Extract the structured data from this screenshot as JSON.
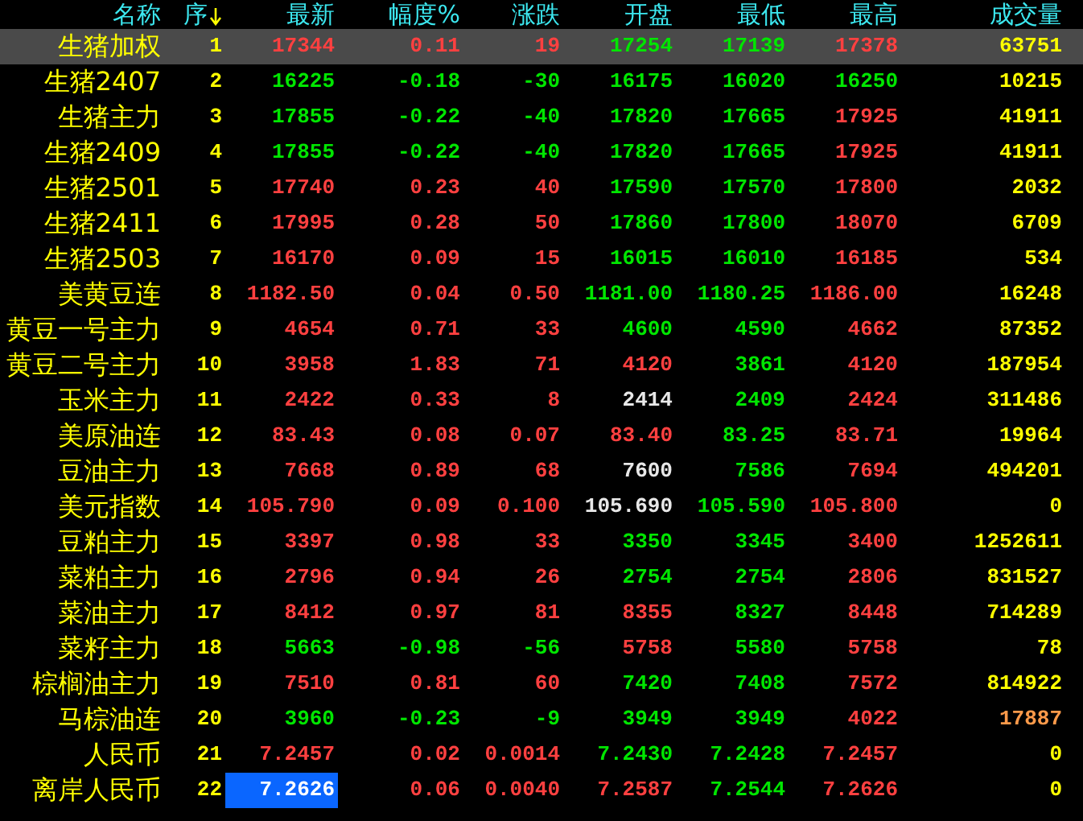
{
  "columns": [
    {
      "label": "名称",
      "sorted_descending": false
    },
    {
      "label": "序",
      "sorted_descending": true
    },
    {
      "label": "最新",
      "sorted_descending": false
    },
    {
      "label": "幅度%",
      "sorted_descending": false
    },
    {
      "label": "涨跌",
      "sorted_descending": false
    },
    {
      "label": "开盘",
      "sorted_descending": false
    },
    {
      "label": "最低",
      "sorted_descending": false
    },
    {
      "label": "最高",
      "sorted_descending": false
    },
    {
      "label": "成交量",
      "sorted_descending": false
    }
  ],
  "rows": [
    {
      "name": "生猪加权",
      "seq": "1",
      "selected": true,
      "cells": [
        {
          "text": "17344",
          "color": "#ff4040"
        },
        {
          "text": "0.11",
          "color": "#ff4040"
        },
        {
          "text": "19",
          "color": "#ff4040"
        },
        {
          "text": "17254",
          "color": "#00e600"
        },
        {
          "text": "17139",
          "color": "#00e600"
        },
        {
          "text": "17378",
          "color": "#ff4040"
        },
        {
          "text": "63751",
          "color": "#ffff00"
        }
      ]
    },
    {
      "name": "生猪2407",
      "seq": "2",
      "selected": false,
      "cells": [
        {
          "text": "16225",
          "color": "#00e600"
        },
        {
          "text": "-0.18",
          "color": "#00e600"
        },
        {
          "text": "-30",
          "color": "#00e600"
        },
        {
          "text": "16175",
          "color": "#00e600"
        },
        {
          "text": "16020",
          "color": "#00e600"
        },
        {
          "text": "16250",
          "color": "#00e600"
        },
        {
          "text": "10215",
          "color": "#ffff00"
        }
      ]
    },
    {
      "name": "生猪主力",
      "seq": "3",
      "selected": false,
      "cells": [
        {
          "text": "17855",
          "color": "#00e600"
        },
        {
          "text": "-0.22",
          "color": "#00e600"
        },
        {
          "text": "-40",
          "color": "#00e600"
        },
        {
          "text": "17820",
          "color": "#00e600"
        },
        {
          "text": "17665",
          "color": "#00e600"
        },
        {
          "text": "17925",
          "color": "#ff4040"
        },
        {
          "text": "41911",
          "color": "#ffff00"
        }
      ]
    },
    {
      "name": "生猪2409",
      "seq": "4",
      "selected": false,
      "cells": [
        {
          "text": "17855",
          "color": "#00e600"
        },
        {
          "text": "-0.22",
          "color": "#00e600"
        },
        {
          "text": "-40",
          "color": "#00e600"
        },
        {
          "text": "17820",
          "color": "#00e600"
        },
        {
          "text": "17665",
          "color": "#00e600"
        },
        {
          "text": "17925",
          "color": "#ff4040"
        },
        {
          "text": "41911",
          "color": "#ffff00"
        }
      ]
    },
    {
      "name": "生猪2501",
      "seq": "5",
      "selected": false,
      "cells": [
        {
          "text": "17740",
          "color": "#ff4040"
        },
        {
          "text": "0.23",
          "color": "#ff4040"
        },
        {
          "text": "40",
          "color": "#ff4040"
        },
        {
          "text": "17590",
          "color": "#00e600"
        },
        {
          "text": "17570",
          "color": "#00e600"
        },
        {
          "text": "17800",
          "color": "#ff4040"
        },
        {
          "text": "2032",
          "color": "#ffff00"
        }
      ]
    },
    {
      "name": "生猪2411",
      "seq": "6",
      "selected": false,
      "cells": [
        {
          "text": "17995",
          "color": "#ff4040"
        },
        {
          "text": "0.28",
          "color": "#ff4040"
        },
        {
          "text": "50",
          "color": "#ff4040"
        },
        {
          "text": "17860",
          "color": "#00e600"
        },
        {
          "text": "17800",
          "color": "#00e600"
        },
        {
          "text": "18070",
          "color": "#ff4040"
        },
        {
          "text": "6709",
          "color": "#ffff00"
        }
      ]
    },
    {
      "name": "生猪2503",
      "seq": "7",
      "selected": false,
      "cells": [
        {
          "text": "16170",
          "color": "#ff4040"
        },
        {
          "text": "0.09",
          "color": "#ff4040"
        },
        {
          "text": "15",
          "color": "#ff4040"
        },
        {
          "text": "16015",
          "color": "#00e600"
        },
        {
          "text": "16010",
          "color": "#00e600"
        },
        {
          "text": "16185",
          "color": "#ff4040"
        },
        {
          "text": "534",
          "color": "#ffff00"
        }
      ]
    },
    {
      "name": "美黄豆连",
      "seq": "8",
      "selected": false,
      "cells": [
        {
          "text": "1182.50",
          "color": "#ff4040"
        },
        {
          "text": "0.04",
          "color": "#ff4040"
        },
        {
          "text": "0.50",
          "color": "#ff4040"
        },
        {
          "text": "1181.00",
          "color": "#00e600"
        },
        {
          "text": "1180.25",
          "color": "#00e600"
        },
        {
          "text": "1186.00",
          "color": "#ff4040"
        },
        {
          "text": "16248",
          "color": "#ffff00"
        }
      ]
    },
    {
      "name": "黄豆一号主力",
      "seq": "9",
      "selected": false,
      "cells": [
        {
          "text": "4654",
          "color": "#ff4040"
        },
        {
          "text": "0.71",
          "color": "#ff4040"
        },
        {
          "text": "33",
          "color": "#ff4040"
        },
        {
          "text": "4600",
          "color": "#00e600"
        },
        {
          "text": "4590",
          "color": "#00e600"
        },
        {
          "text": "4662",
          "color": "#ff4040"
        },
        {
          "text": "87352",
          "color": "#ffff00"
        }
      ]
    },
    {
      "name": "黄豆二号主力",
      "seq": "10",
      "selected": false,
      "cells": [
        {
          "text": "3958",
          "color": "#ff4040"
        },
        {
          "text": "1.83",
          "color": "#ff4040"
        },
        {
          "text": "71",
          "color": "#ff4040"
        },
        {
          "text": "4120",
          "color": "#ff4040"
        },
        {
          "text": "3861",
          "color": "#00e600"
        },
        {
          "text": "4120",
          "color": "#ff4040"
        },
        {
          "text": "187954",
          "color": "#ffff00"
        }
      ]
    },
    {
      "name": "玉米主力",
      "seq": "11",
      "selected": false,
      "cells": [
        {
          "text": "2422",
          "color": "#ff4040"
        },
        {
          "text": "0.33",
          "color": "#ff4040"
        },
        {
          "text": "8",
          "color": "#ff4040"
        },
        {
          "text": "2414",
          "color": "#e8e8e8"
        },
        {
          "text": "2409",
          "color": "#00e600"
        },
        {
          "text": "2424",
          "color": "#ff4040"
        },
        {
          "text": "311486",
          "color": "#ffff00"
        }
      ]
    },
    {
      "name": "美原油连",
      "seq": "12",
      "selected": false,
      "cells": [
        {
          "text": "83.43",
          "color": "#ff4040"
        },
        {
          "text": "0.08",
          "color": "#ff4040"
        },
        {
          "text": "0.07",
          "color": "#ff4040"
        },
        {
          "text": "83.40",
          "color": "#ff4040"
        },
        {
          "text": "83.25",
          "color": "#00e600"
        },
        {
          "text": "83.71",
          "color": "#ff4040"
        },
        {
          "text": "19964",
          "color": "#ffff00"
        }
      ]
    },
    {
      "name": "豆油主力",
      "seq": "13",
      "selected": false,
      "cells": [
        {
          "text": "7668",
          "color": "#ff4040"
        },
        {
          "text": "0.89",
          "color": "#ff4040"
        },
        {
          "text": "68",
          "color": "#ff4040"
        },
        {
          "text": "7600",
          "color": "#e8e8e8"
        },
        {
          "text": "7586",
          "color": "#00e600"
        },
        {
          "text": "7694",
          "color": "#ff4040"
        },
        {
          "text": "494201",
          "color": "#ffff00"
        }
      ]
    },
    {
      "name": "美元指数",
      "seq": "14",
      "selected": false,
      "cells": [
        {
          "text": "105.790",
          "color": "#ff4040"
        },
        {
          "text": "0.09",
          "color": "#ff4040"
        },
        {
          "text": "0.100",
          "color": "#ff4040"
        },
        {
          "text": "105.690",
          "color": "#e8e8e8"
        },
        {
          "text": "105.590",
          "color": "#00e600"
        },
        {
          "text": "105.800",
          "color": "#ff4040"
        },
        {
          "text": "0",
          "color": "#ffff00"
        }
      ]
    },
    {
      "name": "豆粕主力",
      "seq": "15",
      "selected": false,
      "cells": [
        {
          "text": "3397",
          "color": "#ff4040"
        },
        {
          "text": "0.98",
          "color": "#ff4040"
        },
        {
          "text": "33",
          "color": "#ff4040"
        },
        {
          "text": "3350",
          "color": "#00e600"
        },
        {
          "text": "3345",
          "color": "#00e600"
        },
        {
          "text": "3400",
          "color": "#ff4040"
        },
        {
          "text": "1252611",
          "color": "#ffff00"
        }
      ]
    },
    {
      "name": "菜粕主力",
      "seq": "16",
      "selected": false,
      "cells": [
        {
          "text": "2796",
          "color": "#ff4040"
        },
        {
          "text": "0.94",
          "color": "#ff4040"
        },
        {
          "text": "26",
          "color": "#ff4040"
        },
        {
          "text": "2754",
          "color": "#00e600"
        },
        {
          "text": "2754",
          "color": "#00e600"
        },
        {
          "text": "2806",
          "color": "#ff4040"
        },
        {
          "text": "831527",
          "color": "#ffff00"
        }
      ]
    },
    {
      "name": "菜油主力",
      "seq": "17",
      "selected": false,
      "cells": [
        {
          "text": "8412",
          "color": "#ff4040"
        },
        {
          "text": "0.97",
          "color": "#ff4040"
        },
        {
          "text": "81",
          "color": "#ff4040"
        },
        {
          "text": "8355",
          "color": "#ff4040"
        },
        {
          "text": "8327",
          "color": "#00e600"
        },
        {
          "text": "8448",
          "color": "#ff4040"
        },
        {
          "text": "714289",
          "color": "#ffff00"
        }
      ]
    },
    {
      "name": "菜籽主力",
      "seq": "18",
      "selected": false,
      "cells": [
        {
          "text": "5663",
          "color": "#00e600"
        },
        {
          "text": "-0.98",
          "color": "#00e600"
        },
        {
          "text": "-56",
          "color": "#00e600"
        },
        {
          "text": "5758",
          "color": "#ff4040"
        },
        {
          "text": "5580",
          "color": "#00e600"
        },
        {
          "text": "5758",
          "color": "#ff4040"
        },
        {
          "text": "78",
          "color": "#ffff00"
        }
      ]
    },
    {
      "name": "棕榈油主力",
      "seq": "19",
      "selected": false,
      "cells": [
        {
          "text": "7510",
          "color": "#ff4040"
        },
        {
          "text": "0.81",
          "color": "#ff4040"
        },
        {
          "text": "60",
          "color": "#ff4040"
        },
        {
          "text": "7420",
          "color": "#00e600"
        },
        {
          "text": "7408",
          "color": "#00e600"
        },
        {
          "text": "7572",
          "color": "#ff4040"
        },
        {
          "text": "814922",
          "color": "#ffff00"
        }
      ]
    },
    {
      "name": "马棕油连",
      "seq": "20",
      "selected": false,
      "cells": [
        {
          "text": "3960",
          "color": "#00e600"
        },
        {
          "text": "-0.23",
          "color": "#00e600"
        },
        {
          "text": "-9",
          "color": "#00e600"
        },
        {
          "text": "3949",
          "color": "#00e600"
        },
        {
          "text": "3949",
          "color": "#00e600"
        },
        {
          "text": "4022",
          "color": "#ff4040"
        },
        {
          "text": "17887",
          "color": "#ff9a4a"
        }
      ]
    },
    {
      "name": "人民币",
      "seq": "21",
      "selected": false,
      "cells": [
        {
          "text": "7.2457",
          "color": "#ff4040"
        },
        {
          "text": "0.02",
          "color": "#ff4040"
        },
        {
          "text": "0.0014",
          "color": "#ff4040"
        },
        {
          "text": "7.2430",
          "color": "#00e600"
        },
        {
          "text": "7.2428",
          "color": "#00e600"
        },
        {
          "text": "7.2457",
          "color": "#ff4040"
        },
        {
          "text": "0",
          "color": "#ffff00"
        }
      ]
    },
    {
      "name": "离岸人民币",
      "seq": "22",
      "selected": false,
      "cells": [
        {
          "text": "7.2626",
          "color": "#ffffff",
          "highlighted": true
        },
        {
          "text": "0.06",
          "color": "#ff4040"
        },
        {
          "text": "0.0040",
          "color": "#ff4040"
        },
        {
          "text": "7.2587",
          "color": "#ff4040"
        },
        {
          "text": "7.2544",
          "color": "#00e600"
        },
        {
          "text": "7.2626",
          "color": "#ff4040"
        },
        {
          "text": "0",
          "color": "#ffff00"
        }
      ]
    }
  ]
}
